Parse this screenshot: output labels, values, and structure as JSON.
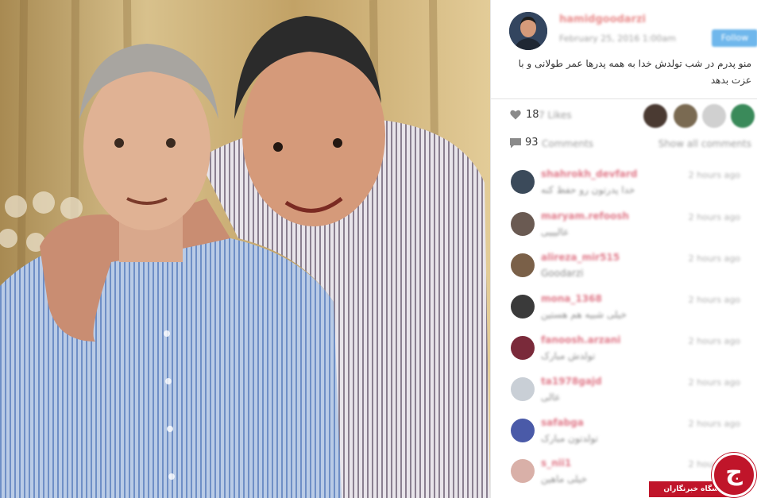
{
  "post": {
    "username": "hamidgoodarzi",
    "timestamp": "February 25, 2016 1:00am",
    "follow_label": "Follow",
    "caption": "منو پدرم در شب تولدش خدا به همه پدرها عمر طولانی و با عزت بدهد"
  },
  "stats": {
    "likes_count": "18",
    "likes_label": "7 Likes",
    "comments_count": "93",
    "comments_label": "Comments",
    "show_all_label": "Show all comments"
  },
  "comments": [
    {
      "user": "shahrokh_devfard",
      "text": "خدا پدرتون رو حفظ کنه",
      "time": "2 hours ago",
      "avatar_color": "#3b4a5a"
    },
    {
      "user": "maryam.refoosh",
      "text": "عالیییی",
      "time": "2 hours ago",
      "avatar_color": "#6a5a52"
    },
    {
      "user": "alireza_mir515",
      "text": "Goodarzi",
      "time": "2 hours ago",
      "avatar_color": "#7a6048"
    },
    {
      "user": "mona_1368",
      "text": "خیلی شبیه هم هستین",
      "time": "2 hours ago",
      "avatar_color": "#3a3a3a"
    },
    {
      "user": "fanoosh.arzani",
      "text": "تولدش مبارک",
      "time": "2 hours ago",
      "avatar_color": "#7a2a3a"
    },
    {
      "user": "ta1978gajd",
      "text": "عالی",
      "time": "2 hours ago",
      "avatar_color": "#c9cfd6"
    },
    {
      "user": "safabga",
      "text": "تولدتون مبارک",
      "time": "2 hours ago",
      "avatar_color": "#4a5aa8"
    },
    {
      "user": "s_nii1",
      "text": "خیلی ماهین",
      "time": "2 hours ago",
      "avatar_color": "#d9b0a8"
    }
  ],
  "watermark": {
    "bar_text": "باشگاه خبرنگاران",
    "glyph": "ج"
  },
  "colors": {
    "accent_red": "#c0152a",
    "follow_blue": "#6fb7ec",
    "username_pink": "#e98a8a"
  }
}
